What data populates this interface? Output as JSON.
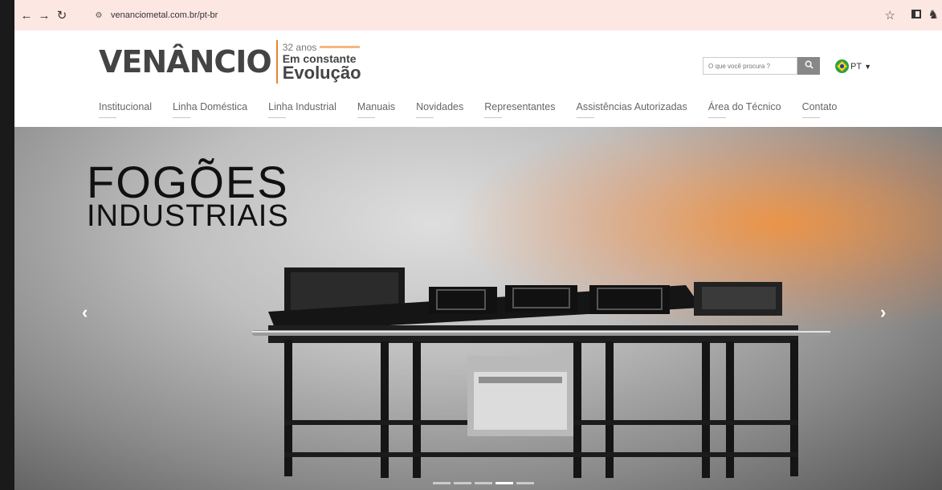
{
  "browser": {
    "url": "venanciometal.com.br/pt-br"
  },
  "logo": {
    "wordmark": "VENÂNCIO",
    "years": "32 anos",
    "tagline_1": "Em constante",
    "tagline_2": "Evolução"
  },
  "search": {
    "placeholder": "O que você procura ?"
  },
  "language": {
    "label": "PT"
  },
  "nav": {
    "items": [
      {
        "label": "Institucional"
      },
      {
        "label": "Linha Doméstica"
      },
      {
        "label": "Linha Industrial"
      },
      {
        "label": "Manuais"
      },
      {
        "label": "Novidades"
      },
      {
        "label": "Representantes"
      },
      {
        "label": "Assistências Autorizadas"
      },
      {
        "label": "Área do Técnico"
      },
      {
        "label": "Contato"
      }
    ]
  },
  "hero": {
    "title_line1": "FOGÕES",
    "title_line2": "INDUSTRIAIS",
    "slides_count": 5,
    "active_slide": 4
  },
  "colors": {
    "browser_bar": "#fde7e3",
    "accent": "#e8842e",
    "logo_text": "#444444"
  }
}
